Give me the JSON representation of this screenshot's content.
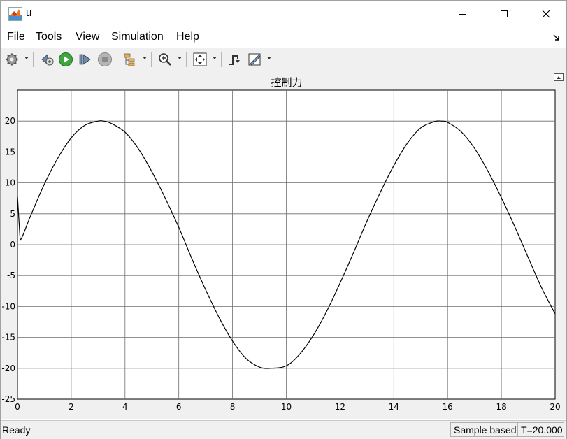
{
  "window": {
    "title": "u",
    "app_icon": "matlab-logo-icon",
    "controls": [
      "minimize-icon",
      "maximize-icon",
      "close-icon"
    ]
  },
  "menu": {
    "items": [
      {
        "label": "File",
        "accel": "F"
      },
      {
        "label": "Tools",
        "accel": "T"
      },
      {
        "label": "View",
        "accel": "V"
      },
      {
        "label": "Simulation",
        "accel": "i"
      },
      {
        "label": "Help",
        "accel": "H"
      }
    ],
    "dock_icon": "dock-arrow-icon"
  },
  "toolbar": {
    "icons": [
      "settings-gear-icon",
      "step-back-icon",
      "run-icon",
      "step-forward-icon",
      "stop-icon",
      "signal-tree-icon",
      "zoom-icon",
      "fit-to-view-icon",
      "triggers-icon",
      "cursor-measure-icon"
    ]
  },
  "plot": {
    "undock_icon": "undock-icon"
  },
  "chart_data": {
    "type": "line",
    "title": "控制力",
    "xlabel": "",
    "ylabel": "",
    "xlim": [
      0,
      20
    ],
    "ylim": [
      -25,
      25
    ],
    "xticks": [
      0,
      2,
      4,
      6,
      8,
      10,
      12,
      14,
      16,
      18,
      20
    ],
    "yticks": [
      -25,
      -20,
      -15,
      -10,
      -5,
      0,
      5,
      10,
      15,
      20
    ],
    "grid": true,
    "line_color": "#000000",
    "series": [
      {
        "x": [
          0,
          0.1,
          0.2,
          0.5,
          1.0,
          1.5,
          2.0,
          2.5,
          3.0,
          3.2,
          3.5,
          4.0,
          4.5,
          5.0,
          5.5,
          6.0,
          6.5,
          7.0,
          7.5,
          8.0,
          8.5,
          9.0,
          9.4,
          10.0,
          10.5,
          11.0,
          11.5,
          12.0,
          12.5,
          13.0,
          13.5,
          14.0,
          14.5,
          15.0,
          15.5,
          15.75,
          16.0,
          16.5,
          17.0,
          17.5,
          18.0,
          18.5,
          19.0,
          19.5,
          20.0
        ],
        "y": [
          7.8,
          0.7,
          1.5,
          4.8,
          9.8,
          14.0,
          17.3,
          19.3,
          20.0,
          20.0,
          19.6,
          18.2,
          15.5,
          11.8,
          7.5,
          2.8,
          -2.4,
          -7.3,
          -11.8,
          -15.6,
          -18.4,
          -19.8,
          -20.0,
          -19.6,
          -17.7,
          -14.7,
          -10.8,
          -6.2,
          -1.3,
          3.8,
          8.5,
          12.8,
          16.4,
          18.9,
          19.9,
          20.0,
          19.8,
          18.3,
          15.6,
          11.9,
          7.6,
          2.9,
          -2.1,
          -7.0,
          -11.2
        ]
      }
    ]
  },
  "status": {
    "left": "Ready",
    "mode": "Sample based",
    "time": "T=20.000"
  }
}
